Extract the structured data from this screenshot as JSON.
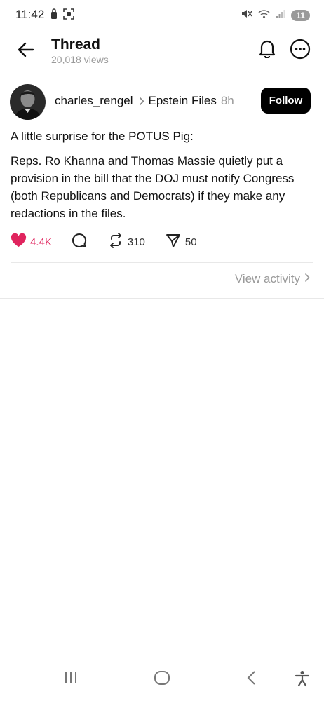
{
  "status_bar": {
    "time": "11:42",
    "battery": "11",
    "icons": [
      "lock-icon",
      "screenshot-icon",
      "mute-icon",
      "wifi-icon",
      "signal-icon"
    ]
  },
  "header": {
    "title": "Thread",
    "views": "20,018 views",
    "icons": [
      "back-arrow-icon",
      "bell-icon",
      "more-icon"
    ]
  },
  "post": {
    "author": "charles_rengel",
    "community": "Epstein Files",
    "time": "8h",
    "follow_label": "Follow",
    "text_lines": [
      "A little surprise for the POTUS Pig:",
      "Reps. Ro Khanna and Thomas Massie quietly put a provision in the bill that the DOJ must notify Congress (both Republicans and Democrats) if they make any redactions in the files."
    ],
    "likes": "4.4K",
    "reposts": "310",
    "shares": "50",
    "view_activity": "View activity",
    "accent_color": "#e0245e"
  },
  "nav_bar": {
    "icons": [
      "recents-icon",
      "home-icon",
      "back-icon",
      "accessibility-icon"
    ]
  }
}
